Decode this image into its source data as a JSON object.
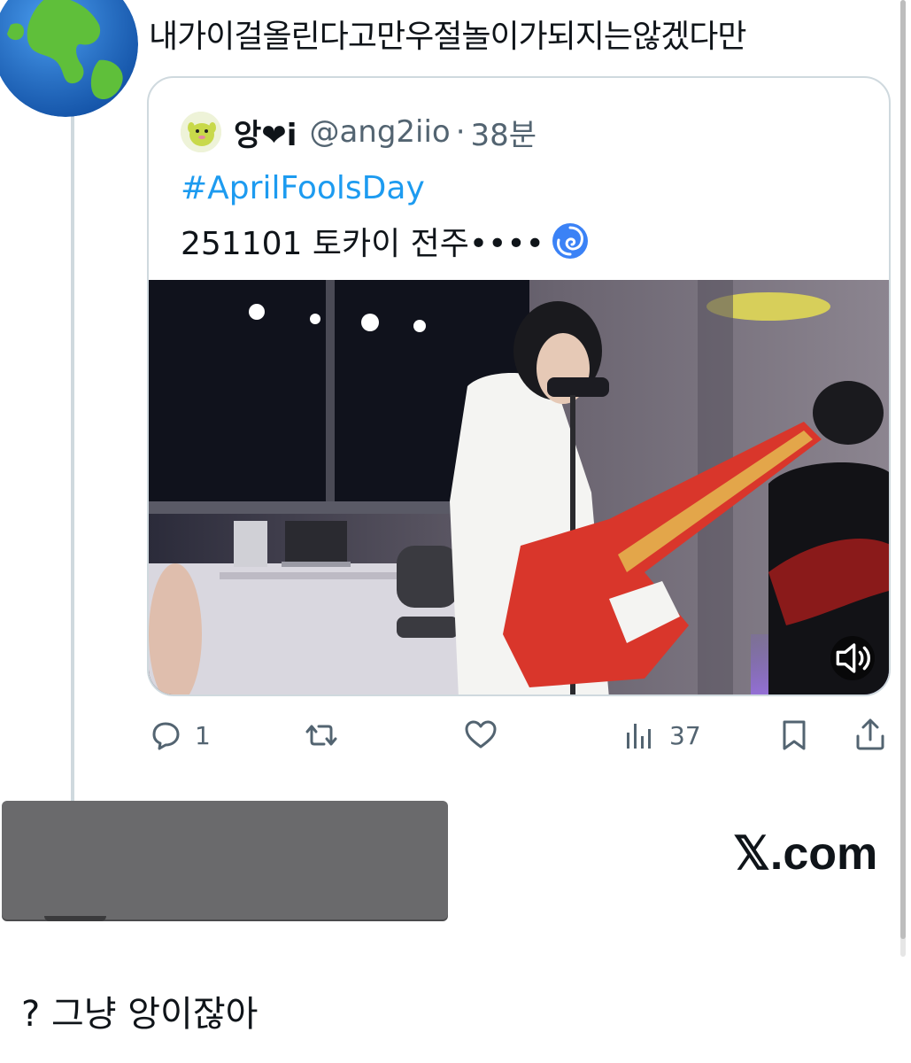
{
  "reply": {
    "text": "내가이걸올린다고만우절놀이가되지는않겠다만"
  },
  "quote": {
    "name": "앙❤i",
    "handle": "@ang2iio",
    "separator": "·",
    "time": "38분",
    "hashtag": "#AprilFoolsDay",
    "body": "251101 토카이 전주••••"
  },
  "actions": {
    "reply_count": "1",
    "retweet_count": "",
    "like_count": "",
    "views_count": "37"
  },
  "watermark": {
    "site": "𝕏.com"
  },
  "bottom": {
    "text": "? 그냥  앙이잖아"
  },
  "colors": {
    "hashtag": "#1d9bf0",
    "secondary_text": "#536471",
    "border": "#cfd9de"
  },
  "icons": [
    "globe-avatar",
    "mascot-avatar",
    "cyclone-emoji",
    "speaker-icon",
    "reply-icon",
    "retweet-icon",
    "like-icon",
    "views-icon",
    "bookmark-icon",
    "share-icon"
  ]
}
